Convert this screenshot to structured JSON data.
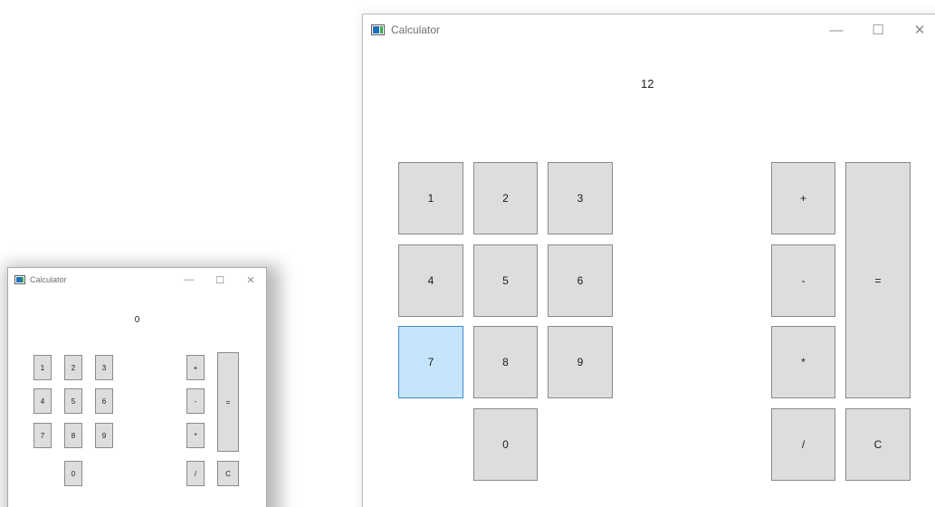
{
  "windows": {
    "small": {
      "title": "Calculator",
      "display": "0",
      "controls": {
        "minimize": "—",
        "maximize": "☐",
        "close": "✕"
      }
    },
    "large": {
      "title": "Calculator",
      "display": "12",
      "controls": {
        "minimize": "—",
        "maximize": "☐",
        "close": "✕"
      }
    }
  },
  "keys": {
    "k1": "1",
    "k2": "2",
    "k3": "3",
    "k4": "4",
    "k5": "5",
    "k6": "6",
    "k7": "7",
    "k8": "8",
    "k9": "9",
    "k0": "0",
    "plus": "+",
    "minus": "-",
    "multiply": "*",
    "divide": "/",
    "equals": "=",
    "clear": "C"
  },
  "colors": {
    "key_face": "#dddddd",
    "key_hover": "#c5e5fb",
    "key_hover_border": "#3c8ad4"
  },
  "hovered_key": "7"
}
